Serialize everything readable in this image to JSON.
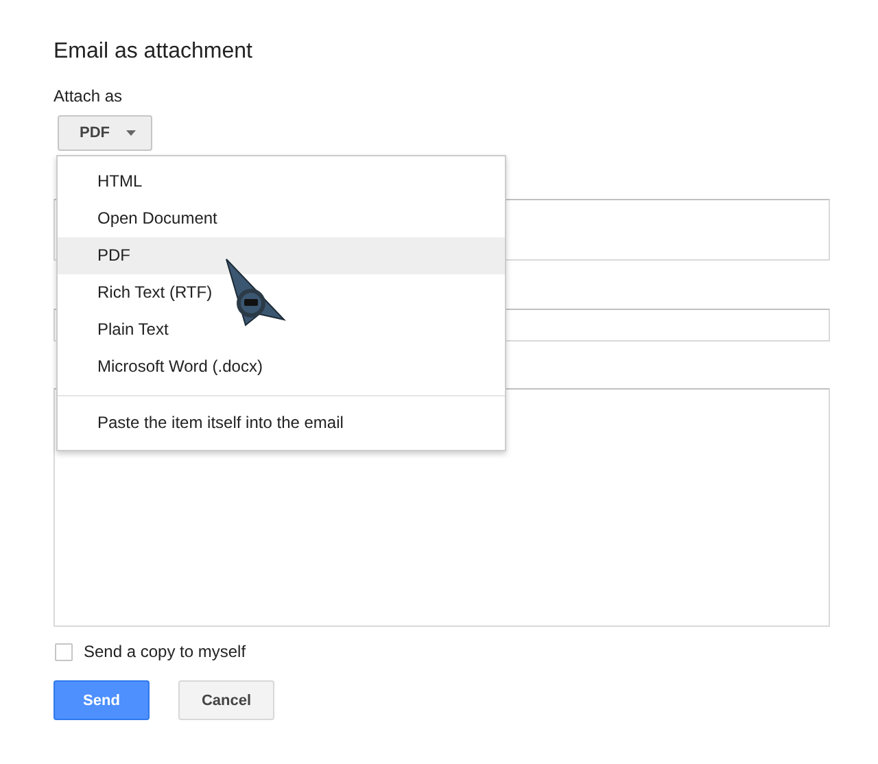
{
  "title": "Email as attachment",
  "attach_label": "Attach as",
  "format_button": {
    "label": "PDF",
    "expanded": true
  },
  "menu": {
    "items": [
      {
        "label": "HTML",
        "selected": false
      },
      {
        "label": "Open Document",
        "selected": false
      },
      {
        "label": "PDF",
        "selected": true
      },
      {
        "label": "Rich Text (RTF)",
        "selected": false
      },
      {
        "label": "Plain Text",
        "selected": false
      },
      {
        "label": "Microsoft Word (.docx)",
        "selected": false
      }
    ],
    "extra_item": "Paste the item itself into the email"
  },
  "copy_checkbox": {
    "label": "Send a copy to myself",
    "checked": false
  },
  "buttons": [
    {
      "label": "Send",
      "kind": "primary"
    },
    {
      "label": "Cancel",
      "kind": "secondary"
    }
  ]
}
